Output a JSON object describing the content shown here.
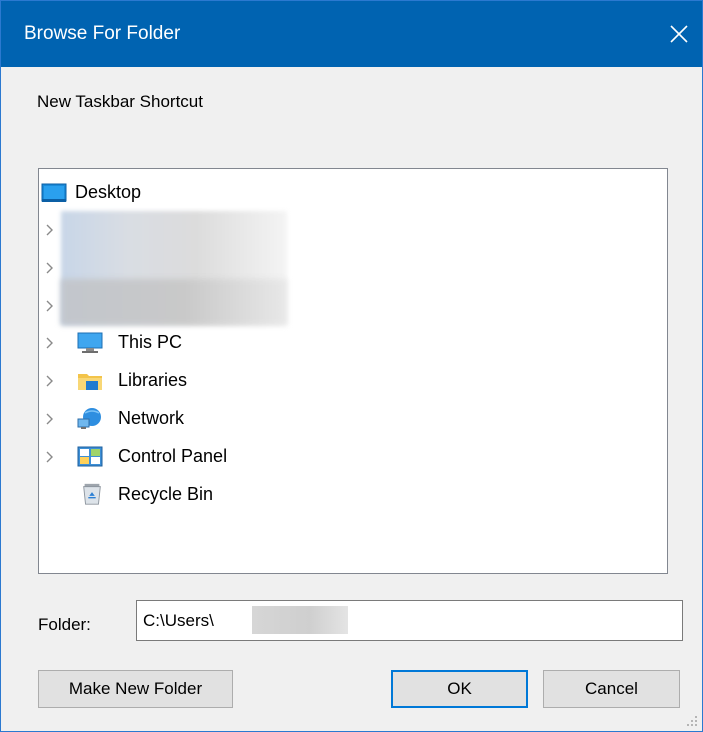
{
  "window": {
    "title": "Browse For Folder",
    "prompt": "New Taskbar Shortcut"
  },
  "tree": {
    "root": {
      "label": "Desktop",
      "icon": "desktop-icon"
    },
    "items": [
      {
        "label": "This PC",
        "icon": "computer-icon",
        "expandable": true
      },
      {
        "label": "Libraries",
        "icon": "libraries-icon",
        "expandable": true
      },
      {
        "label": "Network",
        "icon": "network-icon",
        "expandable": true
      },
      {
        "label": "Control Panel",
        "icon": "control-panel-icon",
        "expandable": true
      },
      {
        "label": "Recycle Bin",
        "icon": "recycle-bin-icon",
        "expandable": false
      }
    ]
  },
  "folder": {
    "label": "Folder:",
    "value": "C:\\Users\\"
  },
  "buttons": {
    "make_new_folder": "Make New Folder",
    "ok": "OK",
    "cancel": "Cancel"
  },
  "colors": {
    "titlebar": "#0063b1",
    "accent": "#0078d7"
  }
}
